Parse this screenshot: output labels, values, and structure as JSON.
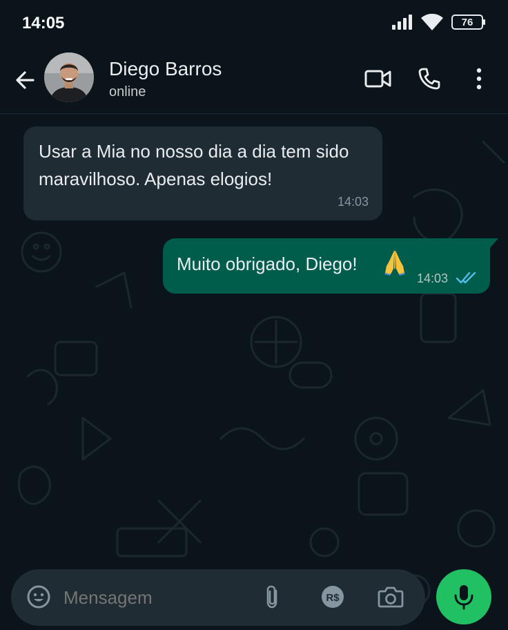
{
  "status_bar": {
    "time": "14:05",
    "battery_level": "76"
  },
  "header": {
    "contact_name": "Diego Barros",
    "contact_status": "online",
    "icons": [
      "back-arrow-icon",
      "video-call-icon",
      "phone-icon",
      "more-options-icon"
    ]
  },
  "messages": [
    {
      "direction": "incoming",
      "text": "Usar a Mia no nosso dia a dia tem sido maravilhoso. Apenas elogios!",
      "time": "14:03"
    },
    {
      "direction": "outgoing",
      "text": "Muito obrigado, Diego!",
      "emoji": "folded-hands",
      "time": "14:03",
      "status": "read"
    }
  ],
  "composer": {
    "placeholder": "Mensagem",
    "icons": [
      "emoji-icon",
      "attach-icon",
      "payment-icon",
      "camera-icon",
      "mic-icon"
    ]
  },
  "colors": {
    "background": "#0b141a",
    "incoming_bubble": "#1f2c33",
    "outgoing_bubble": "#005c4b",
    "accent_green": "#21c063",
    "read_ticks": "#53bdeb"
  }
}
